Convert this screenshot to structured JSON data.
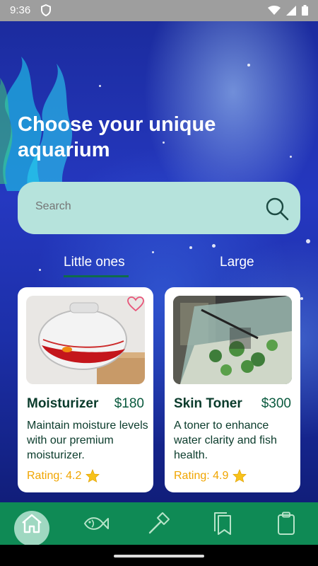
{
  "status": {
    "time": "9:36"
  },
  "hero": {
    "title": "Choose your unique aquarium"
  },
  "search": {
    "placeholder": "Search"
  },
  "tabs": [
    {
      "label": "Little ones",
      "active": true
    },
    {
      "label": "Large",
      "active": false
    }
  ],
  "products": [
    {
      "title": "Moisturizer",
      "price": "$180",
      "description": "Maintain moisture levels with our premium moisturizer.",
      "rating": "Rating: 4.2",
      "image": "fishbowl-with-goldfish",
      "favorite_icon": "heart-outline-icon"
    },
    {
      "title": "Skin Toner",
      "price": "$300",
      "description": "A toner to enhance water clarity and fish health.",
      "rating": "Rating: 4.9",
      "image": "planted-aquarium-tank"
    }
  ],
  "bottom_nav": [
    {
      "icon": "home-icon",
      "active": true
    },
    {
      "icon": "fish-icon",
      "active": false
    },
    {
      "icon": "hammer-icon",
      "active": false
    },
    {
      "icon": "bookmarks-icon",
      "active": false
    },
    {
      "icon": "clipboard-icon",
      "active": false
    }
  ],
  "colors": {
    "accent": "#0f8a55",
    "search_bg": "#b6e3dc",
    "rating": "#f0a500",
    "title_text": "#0a3b2b"
  }
}
